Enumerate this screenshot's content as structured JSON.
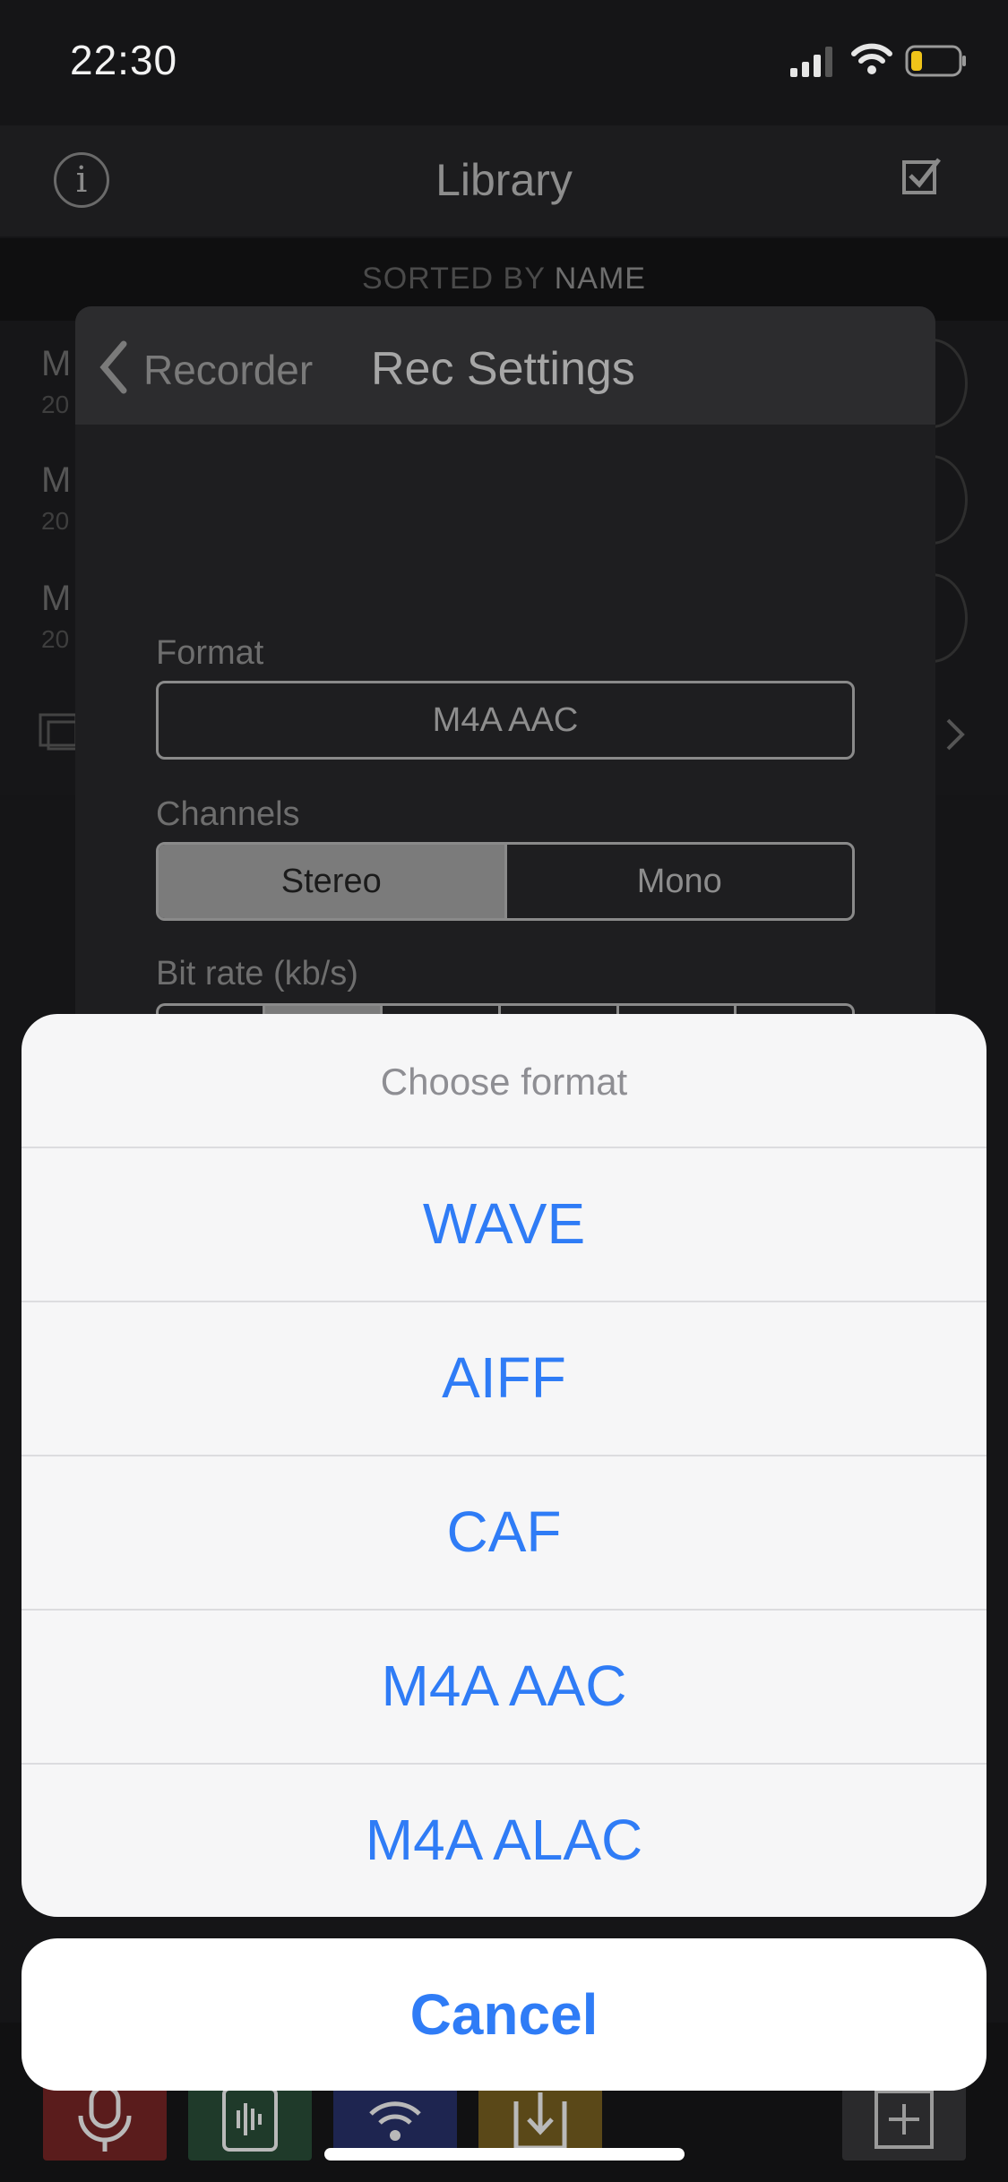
{
  "status_bar": {
    "time": "22:30"
  },
  "navbar": {
    "title": "Library",
    "info_glyph": "i"
  },
  "sorted_bar": {
    "prefix": "SORTED BY",
    "key": "NAME"
  },
  "library_rows": [
    {
      "letter": "M",
      "sub": "20"
    },
    {
      "letter": "M",
      "sub": "20"
    },
    {
      "letter": "M",
      "sub": "20"
    }
  ],
  "rec_settings": {
    "back_label": "Recorder",
    "title": "Rec Settings",
    "format_label": "Format",
    "format_value": "M4A AAC",
    "channels_label": "Channels",
    "channels": [
      {
        "label": "Stereo",
        "selected": true
      },
      {
        "label": "Mono",
        "selected": false
      }
    ],
    "bitrate_label": "Bit rate (kb/s)"
  },
  "action_sheet": {
    "title": "Choose format",
    "options": [
      "WAVE",
      "AIFF",
      "CAF",
      "M4A AAC",
      "M4A ALAC"
    ],
    "cancel": "Cancel"
  },
  "tabbar": {
    "tabs": [
      {
        "icon": "microphone-icon",
        "color": "#5a1c1c"
      },
      {
        "icon": "waveform-icon",
        "color": "#1f3a2a"
      },
      {
        "icon": "wifi-icon",
        "color": "#1e2550"
      },
      {
        "icon": "download-icon",
        "color": "#5a4818"
      }
    ],
    "add_icon": "plus-icon"
  },
  "colors": {
    "accent_blue": "#2f7cf6",
    "sheet_bg": "#f6f6f7"
  }
}
